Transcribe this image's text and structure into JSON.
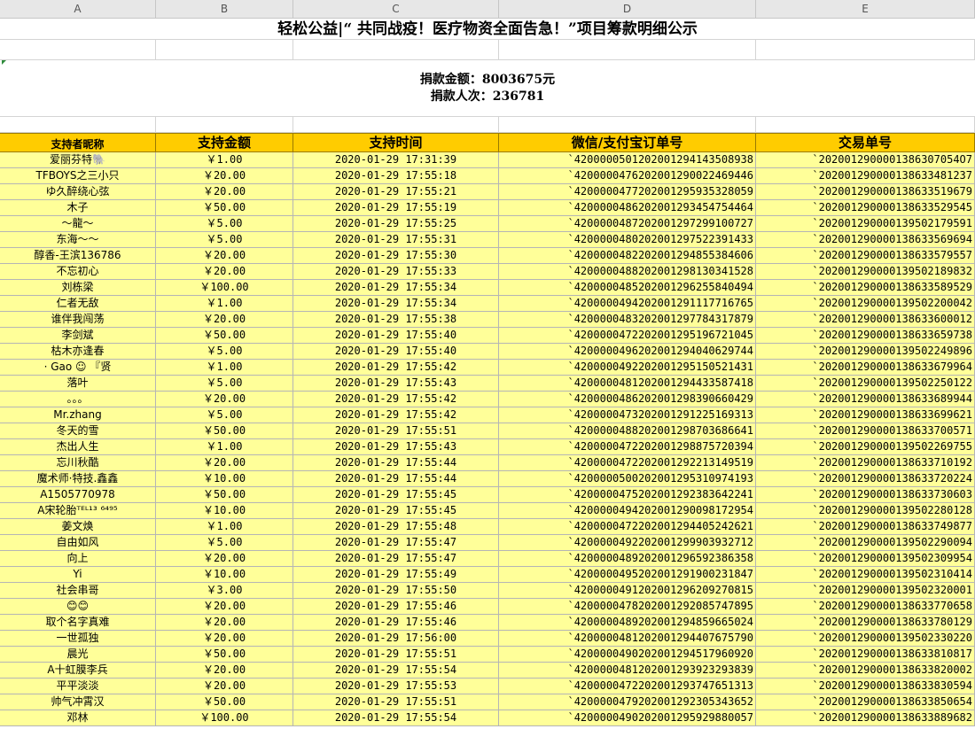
{
  "columns": [
    "A",
    "B",
    "C",
    "D",
    "E"
  ],
  "title": "轻松公益|“ 共同战疫！医疗物资全面告急！”项目筹款明细公示",
  "summary": {
    "amount": "捐款金额：8003675元",
    "count": "捐款人次：236781"
  },
  "headers": {
    "name": "支持者昵称",
    "amount": "支持金额",
    "time": "支持时间",
    "order": "微信/支付宝订单号",
    "trade": "交易单号"
  },
  "rows": [
    {
      "name": "爱丽芬特🐘",
      "amount": "￥1.00",
      "time": "2020-01-29 17:31:39",
      "order": "`4200000501202001294143508938",
      "trade": "`2020012900001386307054O7"
    },
    {
      "name": "TFBOYS之三小只",
      "amount": "￥20.00",
      "time": "2020-01-29 17:55:18",
      "order": "`4200000476202001290022469446",
      "trade": "`2020012900001386334812​37"
    },
    {
      "name": "ゆ久醉绕心弦",
      "amount": "￥20.00",
      "time": "2020-01-29 17:55:21",
      "order": "`4200000477202001295935328059",
      "trade": "`2020012900001386335196​79"
    },
    {
      "name": "木子",
      "amount": "￥50.00",
      "time": "2020-01-29 17:55:19",
      "order": "`4200000486202001293454754464",
      "trade": "`2020012900001386335295​45"
    },
    {
      "name": "～龍～",
      "amount": "￥5.00",
      "time": "2020-01-29 17:55:25",
      "order": "`4200000487202001297299100727",
      "trade": "`2020012900001395021795​91"
    },
    {
      "name": "东海～～",
      "amount": "￥5.00",
      "time": "2020-01-29 17:55:31",
      "order": "`4200000480202001297522391433",
      "trade": "`2020012900001386335696​94"
    },
    {
      "name": "醇香-王滨136786",
      "amount": "￥20.00",
      "time": "2020-01-29 17:55:30",
      "order": "`4200000482202001294855384606",
      "trade": "`2020012900001386335795​57"
    },
    {
      "name": "不忘初心",
      "amount": "￥20.00",
      "time": "2020-01-29 17:55:33",
      "order": "`4200000488202001298130341528",
      "trade": "`2020012900001395021898​32"
    },
    {
      "name": "刘栋梁",
      "amount": "￥100.00",
      "time": "2020-01-29 17:55:34",
      "order": "`4200000485202001296255840494",
      "trade": "`2020012900001386335895​29"
    },
    {
      "name": "仁者无敌",
      "amount": "￥1.00",
      "time": "2020-01-29 17:55:34",
      "order": "`4200000494202001291117716765",
      "trade": "`2020012900001395022000​42"
    },
    {
      "name": "谁伴我闯荡",
      "amount": "￥20.00",
      "time": "2020-01-29 17:55:38",
      "order": "`4200000483202001297784317879",
      "trade": "`2020012900001386336000​12"
    },
    {
      "name": "李剑斌",
      "amount": "￥50.00",
      "time": "2020-01-29 17:55:40",
      "order": "`4200000472202001295196721045",
      "trade": "`2020012900001386336597​38"
    },
    {
      "name": "枯木亦逢春",
      "amount": "￥5.00",
      "time": "2020-01-29 17:55:40",
      "order": "`4200000496202001294040629744",
      "trade": "`2020012900001395022498​96"
    },
    {
      "name": "· Gao ☺ 『贤",
      "amount": "￥1.00",
      "time": "2020-01-29 17:55:42",
      "order": "`4200000492202001295150521431",
      "trade": "`2020012900001386336799​64"
    },
    {
      "name": "落叶",
      "amount": "￥5.00",
      "time": "2020-01-29 17:55:43",
      "order": "`4200000481202001294433587418",
      "trade": "`2020012900001395022501​22"
    },
    {
      "name": "。。。",
      "amount": "￥20.00",
      "time": "2020-01-29 17:55:42",
      "order": "`4200000486202001298390660429",
      "trade": "`2020012900001386336899​44"
    },
    {
      "name": "Mr.zhang",
      "amount": "￥5.00",
      "time": "2020-01-29 17:55:42",
      "order": "`4200000473202001291225169313",
      "trade": "`2020012900001386336996​21"
    },
    {
      "name": "冬天的雪",
      "amount": "￥50.00",
      "time": "2020-01-29 17:55:51",
      "order": "`4200000488202001298703686641",
      "trade": "`2020012900001386337005​71"
    },
    {
      "name": "杰出人生",
      "amount": "￥1.00",
      "time": "2020-01-29 17:55:43",
      "order": "`4200000472202001298875720394",
      "trade": "`2020012900001395022697​55"
    },
    {
      "name": "忘川秋酷",
      "amount": "￥20.00",
      "time": "2020-01-29 17:55:44",
      "order": "`4200000472202001292213149519",
      "trade": "`2020012900001386337101​92"
    },
    {
      "name": "魔术师·特技.鑫鑫",
      "amount": "￥10.00",
      "time": "2020-01-29 17:55:44",
      "order": "`4200000500202001295310974193",
      "trade": "`2020012900001386337202​24"
    },
    {
      "name": "A1505770978",
      "amount": "￥50.00",
      "time": "2020-01-29 17:55:45",
      "order": "`4200000475202001292383642241",
      "trade": "`2020012900001386337306​03"
    },
    {
      "name": "A宋轮胎ᵀᴱᴸ¹³ ⁶⁴⁹⁵",
      "amount": "￥10.00",
      "time": "2020-01-29 17:55:45",
      "order": "`4200000494202001290098172954",
      "trade": "`2020012900001395022801​28"
    },
    {
      "name": "姜文焕",
      "amount": "￥1.00",
      "time": "2020-01-29 17:55:48",
      "order": "`4200000472202001294405242621",
      "trade": "`2020012900001386337498​77"
    },
    {
      "name": "自由如风",
      "amount": "￥5.00",
      "time": "2020-01-29 17:55:47",
      "order": "`4200000492202001299903932712",
      "trade": "`2020012900001395022900​94"
    },
    {
      "name": "向上",
      "amount": "￥20.00",
      "time": "2020-01-29 17:55:47",
      "order": "`4200000489202001296592386358",
      "trade": "`2020012900001395023099​54"
    },
    {
      "name": "Yi",
      "amount": "￥10.00",
      "time": "2020-01-29 17:55:49",
      "order": "`4200000495202001291900231847",
      "trade": "`2020012900001395023104​14"
    },
    {
      "name": "社会串哥",
      "amount": "￥3.00",
      "time": "2020-01-29 17:55:50",
      "order": "`4200000491202001296209270815",
      "trade": "`2020012900001395023200​01"
    },
    {
      "name": "😊😊",
      "amount": "￥20.00",
      "time": "2020-01-29 17:55:46",
      "order": "`4200000478202001292085747895",
      "trade": "`2020012900001386337706​58"
    },
    {
      "name": "取个名字真难",
      "amount": "￥20.00",
      "time": "2020-01-29 17:55:46",
      "order": "`4200000489202001294859665024",
      "trade": "`2020012900001386337801​29"
    },
    {
      "name": "一世孤独",
      "amount": "￥20.00",
      "time": "2020-01-29 17:56:00",
      "order": "`4200000481202001294407675790",
      "trade": "`2020012900001395023302​20"
    },
    {
      "name": "晨光",
      "amount": "￥50.00",
      "time": "2020-01-29 17:55:51",
      "order": "`4200000490202001294517960920",
      "trade": "`2020012900001386338108​17"
    },
    {
      "name": "A十虹膜李兵",
      "amount": "￥20.00",
      "time": "2020-01-29 17:55:54",
      "order": "`4200000481202001293923293839",
      "trade": "`2020012900001386338200​02"
    },
    {
      "name": "平平淡淡",
      "amount": "￥20.00",
      "time": "2020-01-29 17:55:53",
      "order": "`4200000472202001293747651313",
      "trade": "`2020012900001386338305​94"
    },
    {
      "name": "帅气冲霄汉",
      "amount": "￥50.00",
      "time": "2020-01-29 17:55:51",
      "order": "`4200000479202001292305343652",
      "trade": "`2020012900001386338506​54"
    },
    {
      "name": "邓林",
      "amount": "￥100.00",
      "time": "2020-01-29 17:55:54",
      "order": "`4200000490202001295929880057",
      "trade": "`2020012900001386338896​82"
    }
  ]
}
